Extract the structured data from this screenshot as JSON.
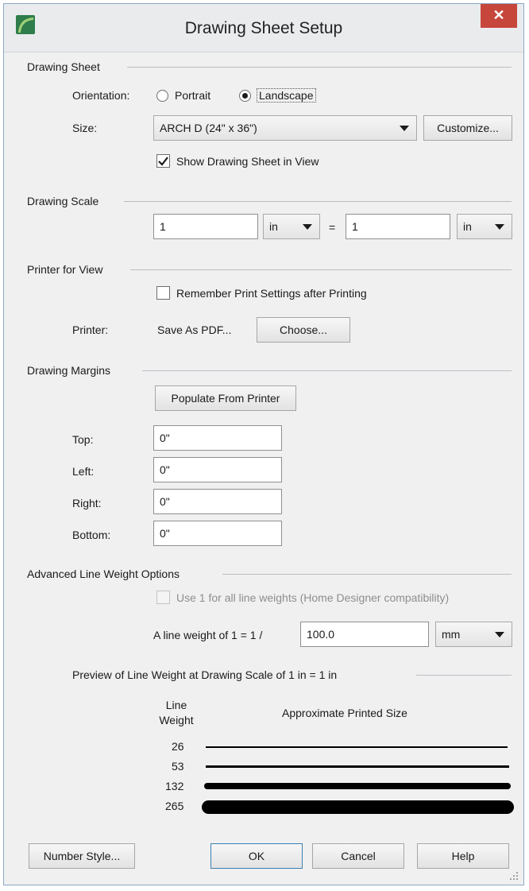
{
  "window": {
    "title": "Drawing Sheet Setup",
    "close_glyph": "✕"
  },
  "drawing_sheet": {
    "heading": "Drawing Sheet",
    "orientation_label": "Orientation:",
    "portrait_label": "Portrait",
    "landscape_label": "Landscape",
    "orientation_selected": "Landscape",
    "size_label": "Size:",
    "size_value": "ARCH D  (24\" x 36\")",
    "customize_label": "Customize...",
    "show_sheet_label": "Show Drawing Sheet in View",
    "show_sheet_checked": true
  },
  "drawing_scale": {
    "heading": "Drawing Scale",
    "left_value": "1",
    "left_unit": "in",
    "equals": "=",
    "right_value": "1",
    "right_unit": "in"
  },
  "printer_for_view": {
    "heading": "Printer for View",
    "remember_label": "Remember Print Settings after Printing",
    "remember_checked": false,
    "printer_label": "Printer:",
    "printer_value": "Save As PDF...",
    "choose_label": "Choose..."
  },
  "drawing_margins": {
    "heading": "Drawing Margins",
    "populate_label": "Populate From Printer",
    "top_label": "Top:",
    "top_value": "0\"",
    "left_label": "Left:",
    "left_value": "0\"",
    "right_label": "Right:",
    "right_value": "0\"",
    "bottom_label": "Bottom:",
    "bottom_value": "0\""
  },
  "advanced_line_weight": {
    "heading": "Advanced Line Weight Options",
    "use1_label": "Use 1 for all line weights (Home Designer compatibility)",
    "use1_checked": false,
    "use1_disabled": true,
    "line_weight_label": "A line weight of 1 = 1 /",
    "line_weight_value": "100.0",
    "line_weight_unit": "mm",
    "preview_heading": "Preview of Line Weight at Drawing Scale of  1 in = 1 in",
    "col_line_weight": "Line\nWeight",
    "col_line_weight_top": "Line",
    "col_line_weight_bottom": "Weight",
    "col_printed_size": "Approximate Printed Size",
    "weights": [
      "26",
      "53",
      "132",
      "265"
    ]
  },
  "footer": {
    "number_style_label": "Number Style...",
    "ok_label": "OK",
    "cancel_label": "Cancel",
    "help_label": "Help"
  }
}
